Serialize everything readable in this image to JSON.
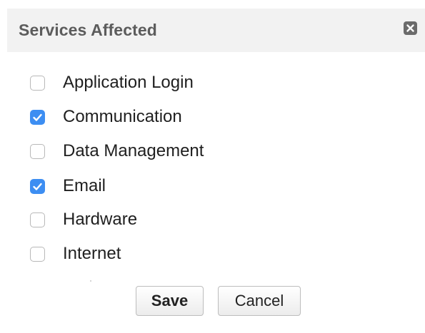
{
  "dialog": {
    "title": "Services Affected",
    "close_icon": "close-icon",
    "accent_color": "#3d8ef2"
  },
  "options": [
    {
      "label": "Application Login",
      "checked": false
    },
    {
      "label": "Communication",
      "checked": true
    },
    {
      "label": "Data Management",
      "checked": false
    },
    {
      "label": "Email",
      "checked": true
    },
    {
      "label": "Hardware",
      "checked": false
    },
    {
      "label": "Internet",
      "checked": false
    }
  ],
  "actions": {
    "save_label": "Save",
    "cancel_label": "Cancel"
  }
}
